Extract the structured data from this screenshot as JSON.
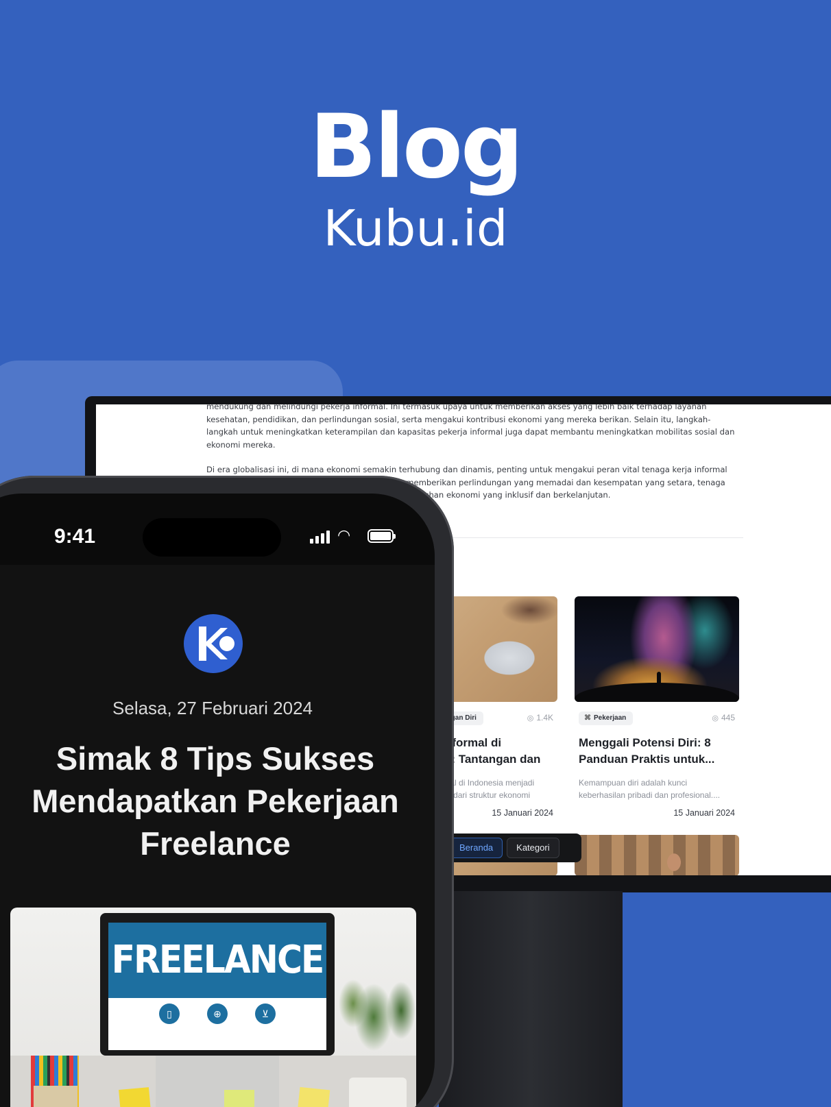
{
  "hero": {
    "title": "Blog",
    "subtitle": "Kubu.id"
  },
  "desktop": {
    "article": {
      "paragraph_1": "mendukung dan melindungi pekerja informal. Ini termasuk upaya untuk memberikan akses yang lebih baik terhadap layanan kesehatan, pendidikan, dan perlindungan sosial, serta mengakui kontribusi ekonomi yang mereka berikan. Selain itu, langkah-langkah untuk meningkatkan keterampilan dan kapasitas pekerja informal juga dapat membantu meningkatkan mobilitas sosial dan ekonomi mereka.",
      "paragraph_2": "Di era globalisasi ini, di mana ekonomi semakin terhubung dan dinamis, penting untuk mengakui peran vital tenaga kerja informal dalam perekonomian dan jaminan sosial. Dengan memberikan perlindungan yang memadai dan kesempatan yang setara, tenaga kerja informal dapat terus berkontribusi pada pertumbuhan ekonomi yang inklusif dan berkelanjutan."
    },
    "cards": [
      {
        "category": "Pengembangan Diri",
        "views": "1.4K",
        "title": "Pekerja Informal di Indonesia: Tantangan dan Peluang",
        "excerpt": "Pekerja informal di Indonesia menjadi bagian penting dari struktur ekonomi nasional.",
        "date": "15 Januari 2024"
      },
      {
        "category": "Pekerjaan",
        "views": "445",
        "title": "Menggali Potensi Diri: 8 Panduan Praktis untuk...",
        "excerpt": "Kemampuan diri adalah kunci keberhasilan pribadi dan profesional....",
        "date": "15 Januari 2024"
      }
    ],
    "nav": {
      "home": "Beranda",
      "category": "Kategori"
    }
  },
  "phone": {
    "status": {
      "time": "9:41"
    },
    "post": {
      "date": "Selasa, 27 Februari 2024",
      "headline": "Simak 8 Tips Sukses Mendapatkan Pekerjaan Freelance",
      "image_banner": "FREELANCE"
    }
  },
  "icons": {
    "views": "eye-icon",
    "category": "grid-icon",
    "wifi": "wifi-icon",
    "battery": "battery-icon",
    "signal": "signal-icon"
  },
  "colors": {
    "background": "#3461BE",
    "accent": "#2F5FD0",
    "phone_screen": "#121212"
  }
}
